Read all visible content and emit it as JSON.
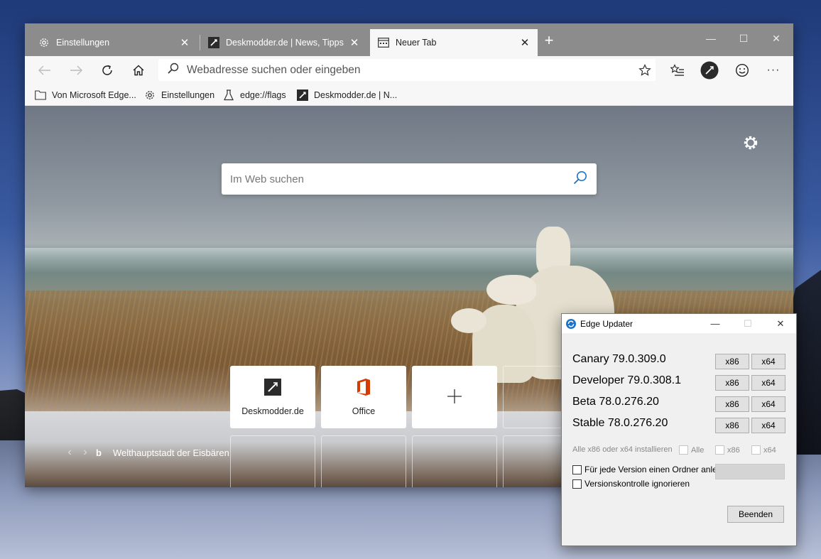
{
  "browser": {
    "tabs": [
      {
        "label": "Einstellungen",
        "icon": "gear-icon",
        "active": false
      },
      {
        "label": "Deskmodder.de | News, Tipps und",
        "icon": "deskmodder-icon",
        "active": false
      },
      {
        "label": "Neuer Tab",
        "icon": "newtab-icon",
        "active": true
      }
    ],
    "new_tab_symbol": "+",
    "window_controls": {
      "minimize": "—",
      "maximize": "☐",
      "close": "✕"
    },
    "address_placeholder": "Webadresse suchen oder eingeben",
    "favorites": [
      {
        "label": "Von Microsoft Edge...",
        "icon": "folder-icon"
      },
      {
        "label": "Einstellungen",
        "icon": "gear-icon"
      },
      {
        "label": "edge://flags",
        "icon": "flask-icon"
      },
      {
        "label": "Deskmodder.de | N...",
        "icon": "deskmodder-icon"
      }
    ],
    "more_symbol": "···"
  },
  "ntp": {
    "search_placeholder": "Im Web suchen",
    "tiles": [
      {
        "label": "Deskmodder.de",
        "icon": "deskmodder-icon"
      },
      {
        "label": "Office",
        "icon": "office-icon"
      },
      {
        "label": "",
        "icon": "add-icon"
      }
    ],
    "image_caption": "Welthauptstadt der Eisbären",
    "prev_symbol": "‹",
    "next_symbol": "›",
    "bing_symbol": "b"
  },
  "updater": {
    "title": "Edge Updater",
    "controls": {
      "minimize": "—",
      "maximize": "☐",
      "close": "✕"
    },
    "versions": [
      {
        "label": "Canary 79.0.309.0",
        "btn_x86": "x86",
        "btn_x64": "x64"
      },
      {
        "label": "Developer 79.0.308.1",
        "btn_x86": "x86",
        "btn_x64": "x64"
      },
      {
        "label": "Beta 78.0.276.20",
        "btn_x86": "x86",
        "btn_x64": "x64"
      },
      {
        "label": "Stable 78.0.276.20",
        "btn_x86": "x86",
        "btn_x64": "x64"
      }
    ],
    "install_all_label": "Alle x86 oder x64 installieren",
    "all_label": "Alle",
    "x86_label": "x86",
    "x64_label": "x64",
    "folder_option": "Für jede Version einen Ordner anlegen",
    "ignore_option": "Versionskontrolle ignorieren",
    "quit_label": "Beenden"
  },
  "colors": {
    "accent_blue": "#1a73c8",
    "office_red": "#d83b01"
  }
}
